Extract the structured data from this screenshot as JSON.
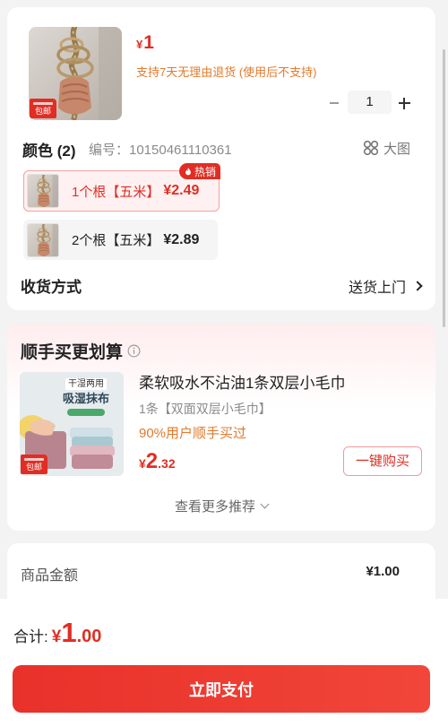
{
  "product": {
    "price_symbol": "¥",
    "price": "1",
    "return_policy": "支持7天无理由退货 (使用后不支持)",
    "image_badge": "包邮"
  },
  "quantity": {
    "value": "1"
  },
  "spec": {
    "title": "颜色 (2)",
    "code": "编号：10150461110361",
    "big_image_label": "大图",
    "options": [
      {
        "name": "1个根【五米】",
        "price": "¥2.49",
        "selected": true,
        "tag": "热销"
      },
      {
        "name": "2个根【五米】",
        "price": "¥2.89",
        "selected": false
      }
    ]
  },
  "delivery": {
    "label": "收货方式",
    "value": "送货上门"
  },
  "addon": {
    "title": "顺手买更划算",
    "item": {
      "image_text_top": "干湿两用",
      "image_text_main": "吸湿抹布",
      "image_badge": "包邮",
      "name": "柔软吸水不沾油1条双层小毛巾",
      "spec": "1条【双面双层小毛巾】",
      "social_proof": "90%用户顺手买过",
      "price_symbol": "¥",
      "price_int": "2",
      "price_dec": ".32",
      "buy_button": "一键购买"
    },
    "more_label": "查看更多推荐"
  },
  "summary": {
    "goods_amount_label": "商品金额",
    "goods_amount": "¥1.00"
  },
  "footer": {
    "total_label": "合计:",
    "total_symbol": "¥",
    "total_int": "1",
    "total_dec": ".00",
    "pay_button": "立即支付"
  },
  "icons": {
    "hot": "fire-icon",
    "big_image": "grid-circles-icon",
    "delivery_arrow": "chevron-right-icon",
    "info": "info-icon",
    "more_arrow": "chevron-down-icon",
    "qty_minus": "minus-icon",
    "qty_plus": "plus-icon"
  },
  "colors": {
    "accent": "#e02e24",
    "orange": "#e27a2c",
    "pay_start": "#e8312a",
    "pay_end": "#f2463a",
    "page_bg": "#f3f3f3"
  }
}
